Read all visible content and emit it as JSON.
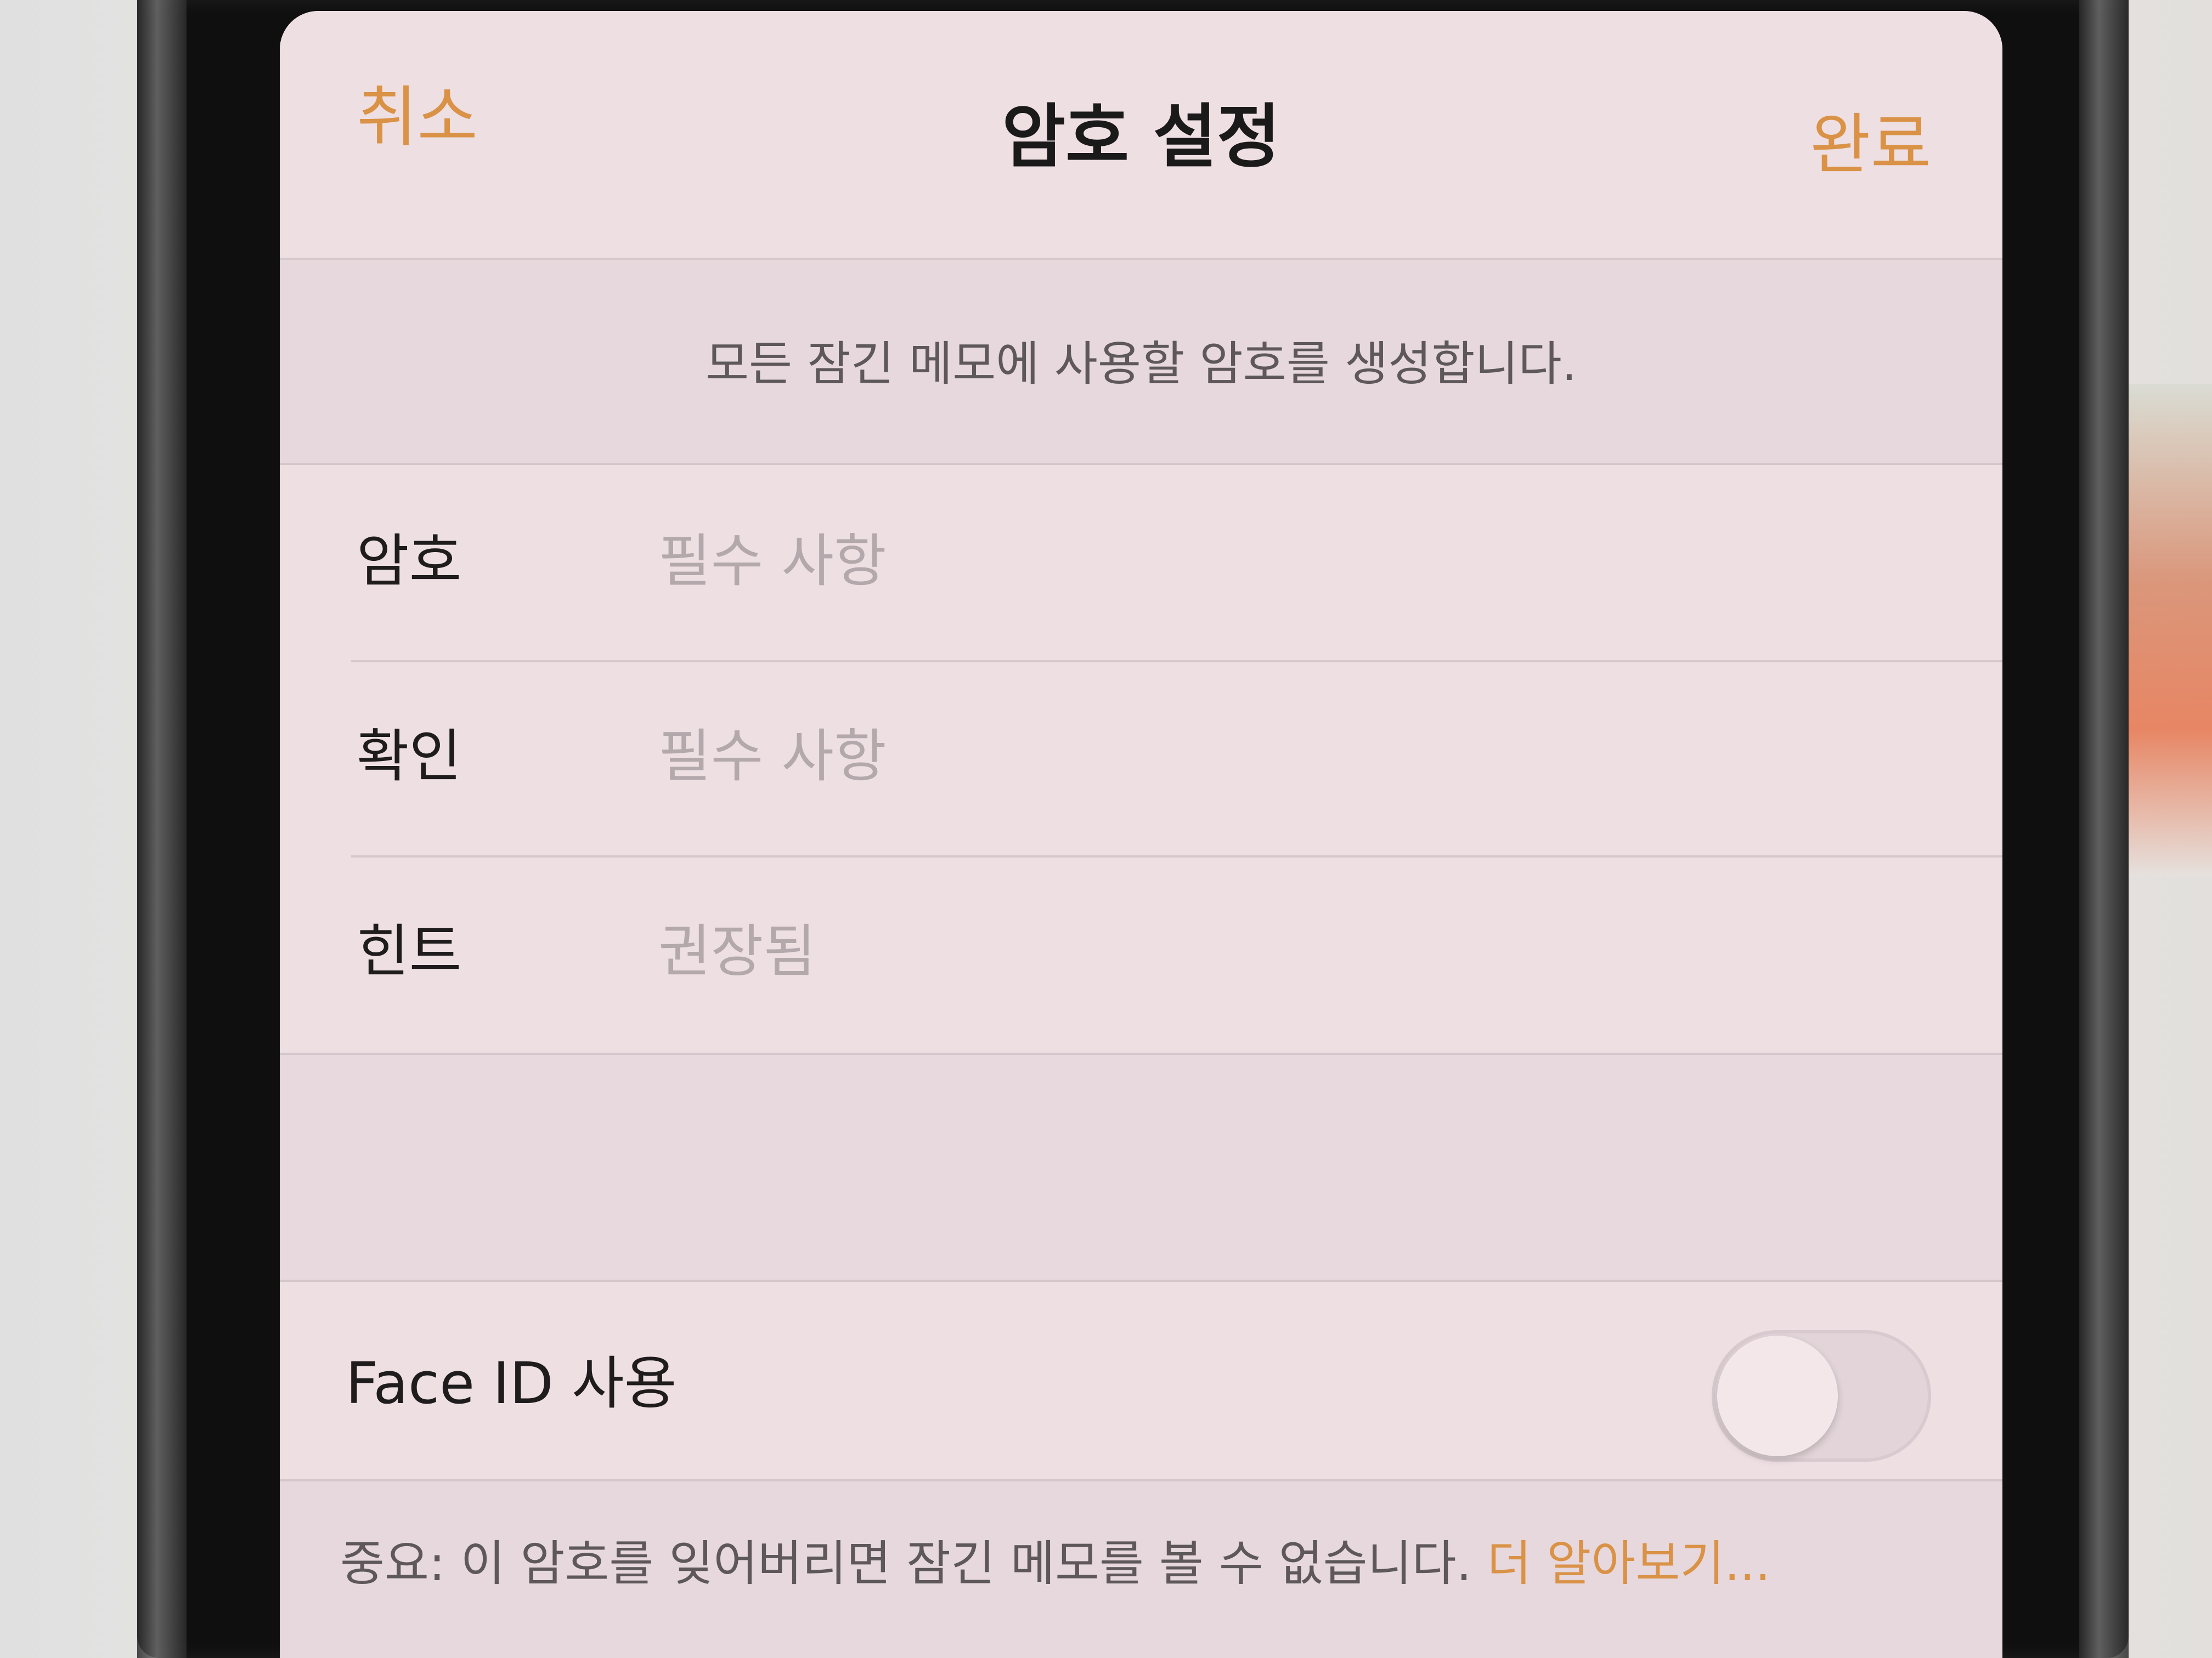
{
  "nav": {
    "cancel_label": "취소",
    "title": "암호 설정",
    "done_label": "완료"
  },
  "description": "모든 잠긴 메모에 사용할 암호를 생성합니다.",
  "fields": [
    {
      "label": "암호",
      "value": "",
      "placeholder": "필수 사항"
    },
    {
      "label": "확인",
      "value": "",
      "placeholder": "필수 사항"
    },
    {
      "label": "힌트",
      "value": "",
      "placeholder": "권장됨"
    }
  ],
  "face_id": {
    "label": "Face ID 사용",
    "enabled": false
  },
  "footer": {
    "note": "중요: 이 암호를 잊어버리면 잠긴 메모를 볼 수 없습니다. ",
    "link_label": "더 알아보기..."
  },
  "colors": {
    "accent": "#d99246",
    "sheet_background": "#eddfe3",
    "grouped_background": "#e6d8dd",
    "text_primary": "#1e1c1d",
    "text_secondary": "#5e585b",
    "placeholder": "#b3a9ad"
  }
}
